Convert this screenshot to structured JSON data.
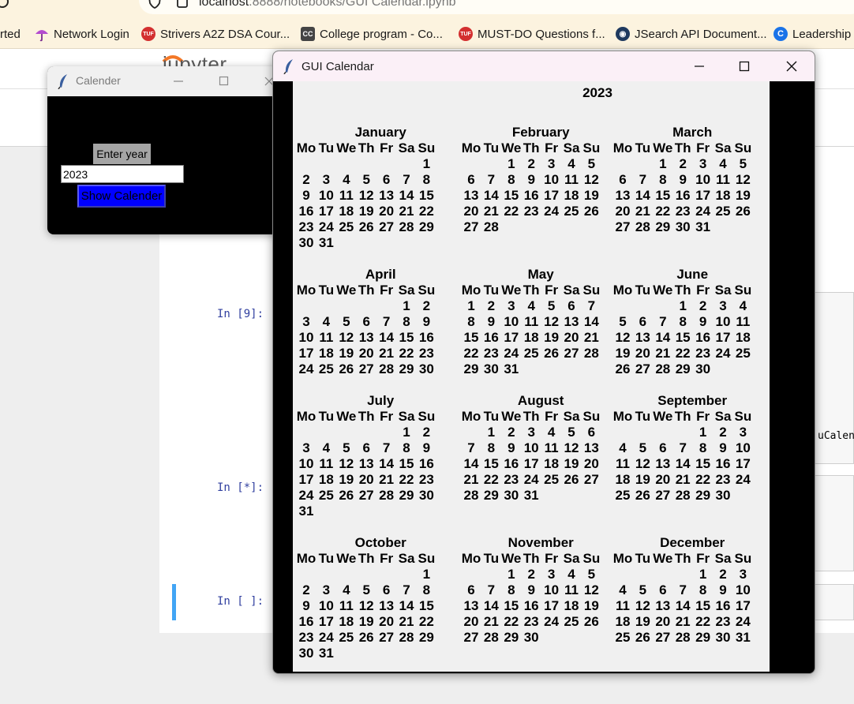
{
  "browser": {
    "url_host": "localhost",
    "url_rest": ":8888/notebooks/GUI Calendar.ipynb",
    "bookmarks": [
      {
        "label": "rted",
        "icon": "none",
        "color": "#000000"
      },
      {
        "label": "Network Login",
        "icon": "umbrella-icon",
        "color": "#a23fc0"
      },
      {
        "label": "Strivers A2Z DSA Cour...",
        "icon": "tuf-icon",
        "color": "#d32f2f"
      },
      {
        "label": "College program - Co...",
        "icon": "cc-icon",
        "color": "#444444"
      },
      {
        "label": "MUST-DO Questions f...",
        "icon": "tuf-icon",
        "color": "#d32f2f"
      },
      {
        "label": "JSearch API Document...",
        "icon": "rapidapi-icon",
        "color": "#1f3a5f"
      },
      {
        "label": "Leadership",
        "icon": "c-icon",
        "color": "#1a73e8"
      }
    ]
  },
  "jupyter": {
    "logo_text": "jupyter",
    "cells": [
      {
        "prompt": "In [9]:"
      },
      {
        "prompt": "In [*]:"
      },
      {
        "prompt": "In [ ]:"
      }
    ],
    "code_fragment": "uCalen"
  },
  "small_window": {
    "title": "Calender",
    "label": "Enter year",
    "input_value": "2023",
    "button_label": "Show Calender"
  },
  "calendar_window": {
    "title": "GUI Calendar",
    "year": "2023",
    "weekdays": [
      "Mo",
      "Tu",
      "We",
      "Th",
      "Fr",
      "Sa",
      "Su"
    ],
    "months": [
      {
        "name": "January",
        "first_weekday": 6,
        "days": 31
      },
      {
        "name": "February",
        "first_weekday": 2,
        "days": 28
      },
      {
        "name": "March",
        "first_weekday": 2,
        "days": 31
      },
      {
        "name": "April",
        "first_weekday": 5,
        "days": 30
      },
      {
        "name": "May",
        "first_weekday": 0,
        "days": 31
      },
      {
        "name": "June",
        "first_weekday": 3,
        "days": 30
      },
      {
        "name": "July",
        "first_weekday": 5,
        "days": 31
      },
      {
        "name": "August",
        "first_weekday": 1,
        "days": 31
      },
      {
        "name": "September",
        "first_weekday": 4,
        "days": 30
      },
      {
        "name": "October",
        "first_weekday": 6,
        "days": 31
      },
      {
        "name": "November",
        "first_weekday": 2,
        "days": 30
      },
      {
        "name": "December",
        "first_weekday": 4,
        "days": 31
      }
    ]
  }
}
